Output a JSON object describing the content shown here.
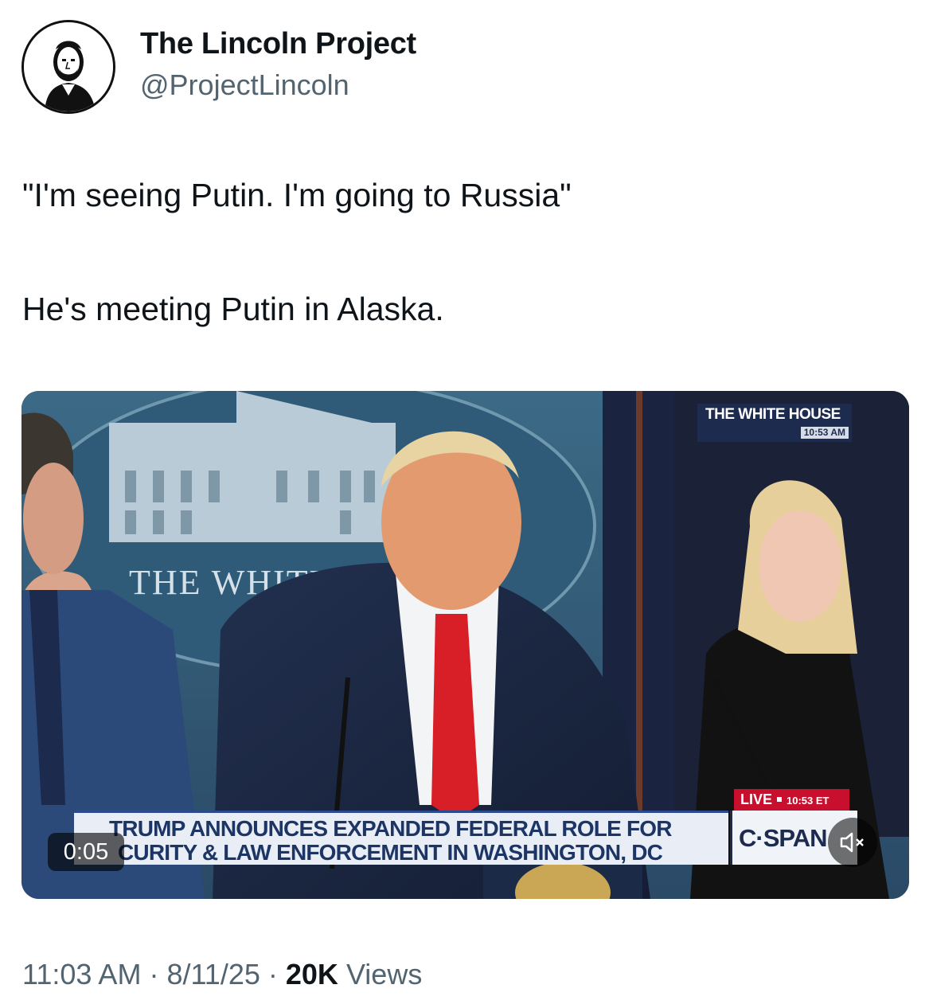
{
  "author": {
    "name": "The Lincoln Project",
    "handle": "@ProjectLincoln",
    "avatar_icon": "lincoln-portrait-icon"
  },
  "tweet": {
    "line1": "\"I'm seeing Putin. I'm going to Russia\"",
    "line2": "He's meeting Putin in Alaska."
  },
  "video": {
    "top_bug": "THE WHITE HOUSE",
    "top_bug_time": "10:53 AM",
    "headline_line1": "TRUMP ANNOUNCES EXPANDED FEDERAL ROLE FOR",
    "headline_line2": "CURITY & LAW ENFORCEMENT IN WASHINGTON, DC",
    "live_label": "LIVE",
    "live_time": "10:53 ET",
    "network": "C·SPAN",
    "backdrop_text": "THE WHITE",
    "elapsed": "0:05",
    "mute_icon": "muted-speaker-icon"
  },
  "meta": {
    "time": "11:03 AM",
    "sep1": " · ",
    "date": "8/11/25",
    "sep2": " · ",
    "views_count": "20K",
    "views_label": " Views"
  }
}
